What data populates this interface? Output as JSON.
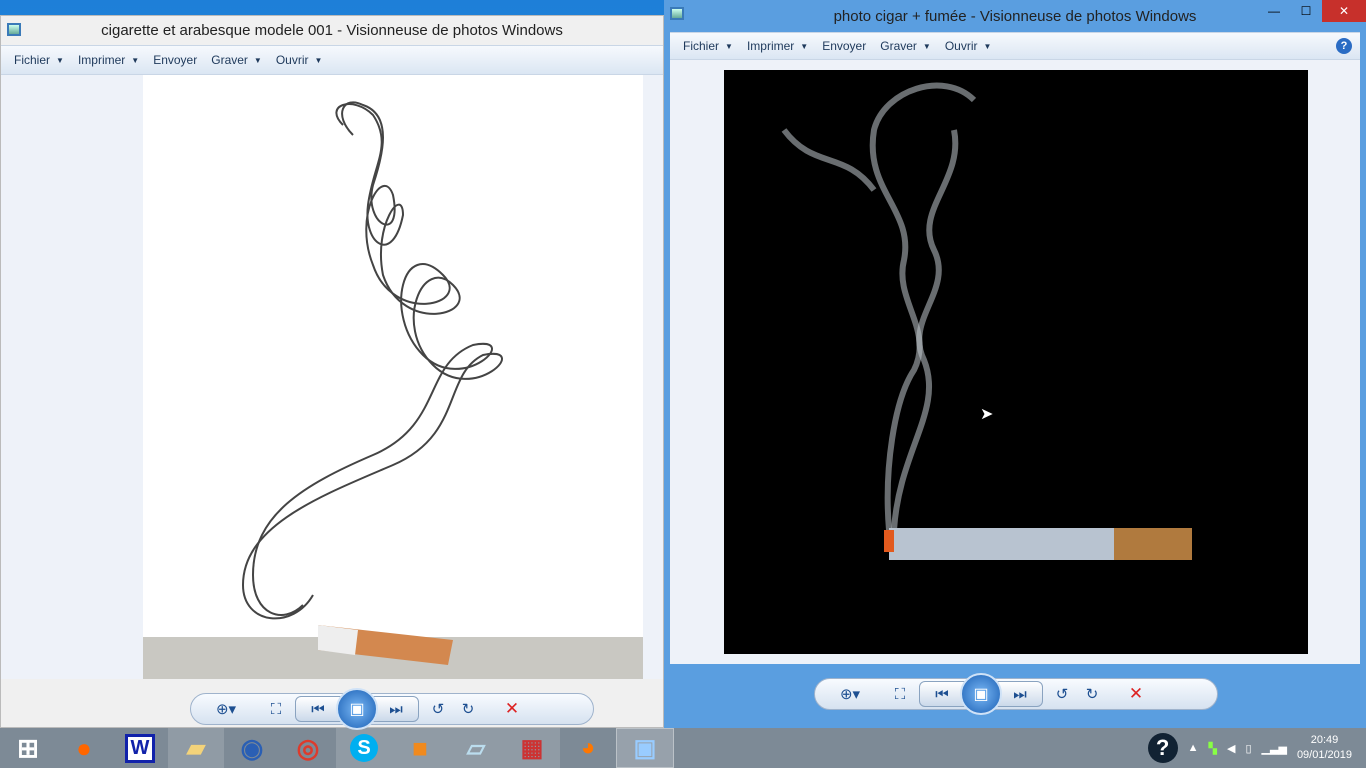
{
  "window_left": {
    "title": "cigarette et arabesque modele 001 - Visionneuse de photos Windows",
    "menu": [
      {
        "label": "Fichier",
        "dropdown": true
      },
      {
        "label": "Imprimer",
        "dropdown": true
      },
      {
        "label": "Envoyer",
        "dropdown": false
      },
      {
        "label": "Graver",
        "dropdown": true
      },
      {
        "label": "Ouvrir",
        "dropdown": true
      }
    ]
  },
  "window_right": {
    "title": "photo cigar + fumée - Visionneuse de photos Windows",
    "menu": [
      {
        "label": "Fichier",
        "dropdown": true
      },
      {
        "label": "Imprimer",
        "dropdown": true
      },
      {
        "label": "Envoyer",
        "dropdown": false
      },
      {
        "label": "Graver",
        "dropdown": true
      },
      {
        "label": "Ouvrir",
        "dropdown": true
      }
    ],
    "help": "?"
  },
  "controls": {
    "zoom": "⊕▾",
    "fit": "⛶",
    "prev": "⏮",
    "slideshow": "▣",
    "next": "⏭",
    "rotate_left": "↺",
    "rotate_right": "↻",
    "delete": "✕"
  },
  "taskbar": {
    "apps": [
      "start",
      "firefox",
      "word",
      "explorer",
      "thunderbird",
      "chrome",
      "skype",
      "pdf",
      "notepad",
      "winrar",
      "blender",
      "photo-viewer"
    ],
    "word_label": "W",
    "skype_label": "S",
    "help": "?"
  },
  "clock": {
    "time": "20:49",
    "date": "09/01/2019"
  }
}
